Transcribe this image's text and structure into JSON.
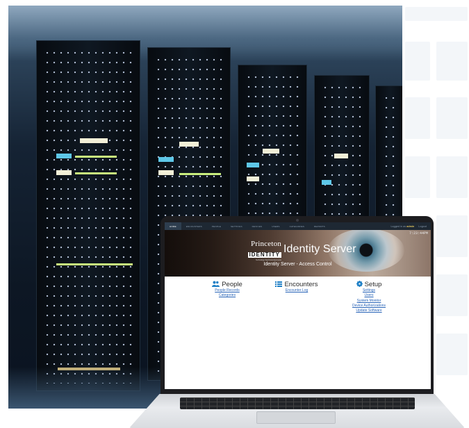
{
  "colors": {
    "accent": "#1f80c6",
    "link": "#2a65b8",
    "navbar": "#1e2833",
    "admin": "#f0d060"
  },
  "navbar": {
    "items": [
      {
        "label": "Home",
        "active": true
      },
      {
        "label": "Encounters"
      },
      {
        "label": "People"
      },
      {
        "label": "Settings"
      },
      {
        "label": "Devices"
      },
      {
        "label": "Users"
      },
      {
        "label": "Categories"
      },
      {
        "label": "Reports"
      }
    ],
    "logged_in_prefix": "Logged in as",
    "user": "admin",
    "logout": "Logout"
  },
  "banner": {
    "clock": "7:23:44PM",
    "logo_line1": "Princeton",
    "logo_line2": "IDENTITY",
    "logo_tagline": "Technology that Knows Everyone",
    "product_title": "Identity Server",
    "subtitle": "Identity Server - Access Control"
  },
  "columns": {
    "people": {
      "icon": "people-icon",
      "title": "People",
      "links": [
        "People Records",
        "Categories"
      ]
    },
    "encounters": {
      "icon": "list-icon",
      "title": "Encounters",
      "links": [
        "Encounter Log"
      ]
    },
    "setup": {
      "icon": "gear-icon",
      "title": "Setup",
      "links": [
        "Settings",
        "Users",
        "System Monitor",
        "Device Authorizations",
        "Update Software"
      ]
    }
  }
}
